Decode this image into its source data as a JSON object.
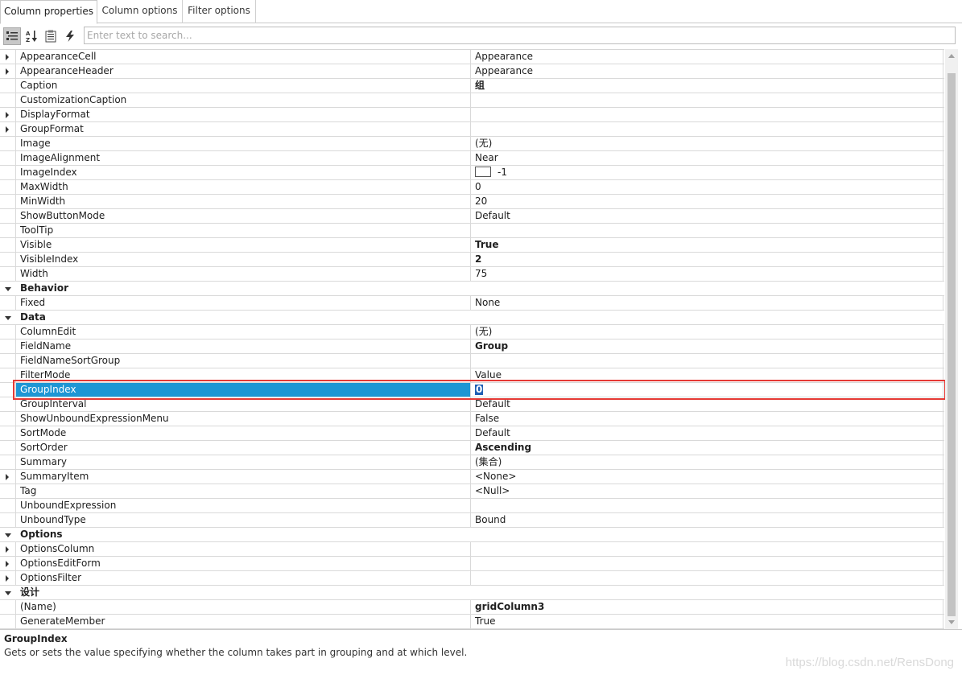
{
  "tabs": [
    {
      "label": "Column properties",
      "active": true
    },
    {
      "label": "Column options",
      "active": false
    },
    {
      "label": "Filter options",
      "active": false
    }
  ],
  "toolbar": {
    "buttons": [
      "categorized-view-icon",
      "alphabetical-sort-icon",
      "property-pages-icon",
      "events-icon"
    ],
    "search_placeholder": "Enter text to search..."
  },
  "rows": [
    {
      "name": "AppearanceCell",
      "value": "Appearance",
      "expander": "collapsed"
    },
    {
      "name": "AppearanceHeader",
      "value": "Appearance",
      "expander": "collapsed"
    },
    {
      "name": "Caption",
      "value": "组",
      "bold": true
    },
    {
      "name": "CustomizationCaption",
      "value": ""
    },
    {
      "name": "DisplayFormat",
      "value": "",
      "expander": "collapsed"
    },
    {
      "name": "GroupFormat",
      "value": "",
      "expander": "collapsed"
    },
    {
      "name": "Image",
      "value": "(无)"
    },
    {
      "name": "ImageAlignment",
      "value": "Near"
    },
    {
      "name": "ImageIndex",
      "value": "-1",
      "swatch": true
    },
    {
      "name": "MaxWidth",
      "value": "0"
    },
    {
      "name": "MinWidth",
      "value": "20"
    },
    {
      "name": "ShowButtonMode",
      "value": "Default"
    },
    {
      "name": "ToolTip",
      "value": ""
    },
    {
      "name": "Visible",
      "value": "True",
      "bold": true
    },
    {
      "name": "VisibleIndex",
      "value": "2",
      "bold": true
    },
    {
      "name": "Width",
      "value": "75"
    },
    {
      "name": "Behavior",
      "category": true
    },
    {
      "name": "Fixed",
      "value": "None"
    },
    {
      "name": "Data",
      "category": true
    },
    {
      "name": "ColumnEdit",
      "value": "(无)"
    },
    {
      "name": "FieldName",
      "value": "Group",
      "bold": true
    },
    {
      "name": "FieldNameSortGroup",
      "value": ""
    },
    {
      "name": "FilterMode",
      "value": "Value"
    },
    {
      "name": "GroupIndex",
      "value": "0",
      "selected": true,
      "editing": true
    },
    {
      "name": "GroupInterval",
      "value": "Default"
    },
    {
      "name": "ShowUnboundExpressionMenu",
      "value": "False"
    },
    {
      "name": "SortMode",
      "value": "Default"
    },
    {
      "name": "SortOrder",
      "value": "Ascending",
      "bold": true
    },
    {
      "name": "Summary",
      "value": "(集合)"
    },
    {
      "name": "SummaryItem",
      "value": "<None>",
      "expander": "collapsed"
    },
    {
      "name": "Tag",
      "value": "<Null>"
    },
    {
      "name": "UnboundExpression",
      "value": ""
    },
    {
      "name": "UnboundType",
      "value": "Bound"
    },
    {
      "name": "Options",
      "category": true
    },
    {
      "name": "OptionsColumn",
      "value": "",
      "expander": "collapsed"
    },
    {
      "name": "OptionsEditForm",
      "value": "",
      "expander": "collapsed"
    },
    {
      "name": "OptionsFilter",
      "value": "",
      "expander": "collapsed"
    },
    {
      "name": "设计",
      "category": true
    },
    {
      "name": "(Name)",
      "value": "gridColumn3",
      "bold": true
    },
    {
      "name": "GenerateMember",
      "value": "True"
    }
  ],
  "description": {
    "title": "GroupIndex",
    "text": "Gets or sets the value specifying whether the column takes part in grouping and at which level."
  },
  "watermark": "https://blog.csdn.net/RensDong",
  "colors": {
    "selection": "#1e96d4",
    "highlight_border": "#e53935"
  }
}
